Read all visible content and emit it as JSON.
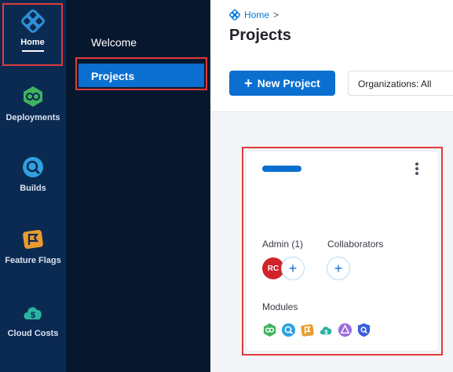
{
  "rail": {
    "items": [
      {
        "label": "Home",
        "icon": "harness-home-icon"
      },
      {
        "label": "Deployments",
        "icon": "deployments-icon"
      },
      {
        "label": "Builds",
        "icon": "builds-icon"
      },
      {
        "label": "Feature Flags",
        "icon": "feature-flags-icon"
      },
      {
        "label": "Cloud Costs",
        "icon": "cloud-costs-icon"
      }
    ]
  },
  "subnav": {
    "items": [
      {
        "label": "Welcome"
      },
      {
        "label": "Projects",
        "selected": true
      }
    ]
  },
  "header": {
    "breadcrumb": {
      "home": "Home",
      "separator": ">"
    },
    "title": "Projects",
    "new_project_label": "New Project",
    "org_select_value": "Organizations: All"
  },
  "card": {
    "color": "#0b6fd0",
    "admin_label": "Admin (1)",
    "admin_avatar": "RC",
    "collaborators_label": "Collaborators",
    "modules_label": "Modules",
    "modules": [
      "cd-icon",
      "ci-icon",
      "ff-icon",
      "ccm-icon",
      "chaos-icon",
      "sto-icon"
    ]
  },
  "colors": {
    "rail_bg": "#0b2a52",
    "subnav_bg": "#07182e",
    "accent": "#0b6fd0",
    "highlight": "#e03b3b"
  }
}
